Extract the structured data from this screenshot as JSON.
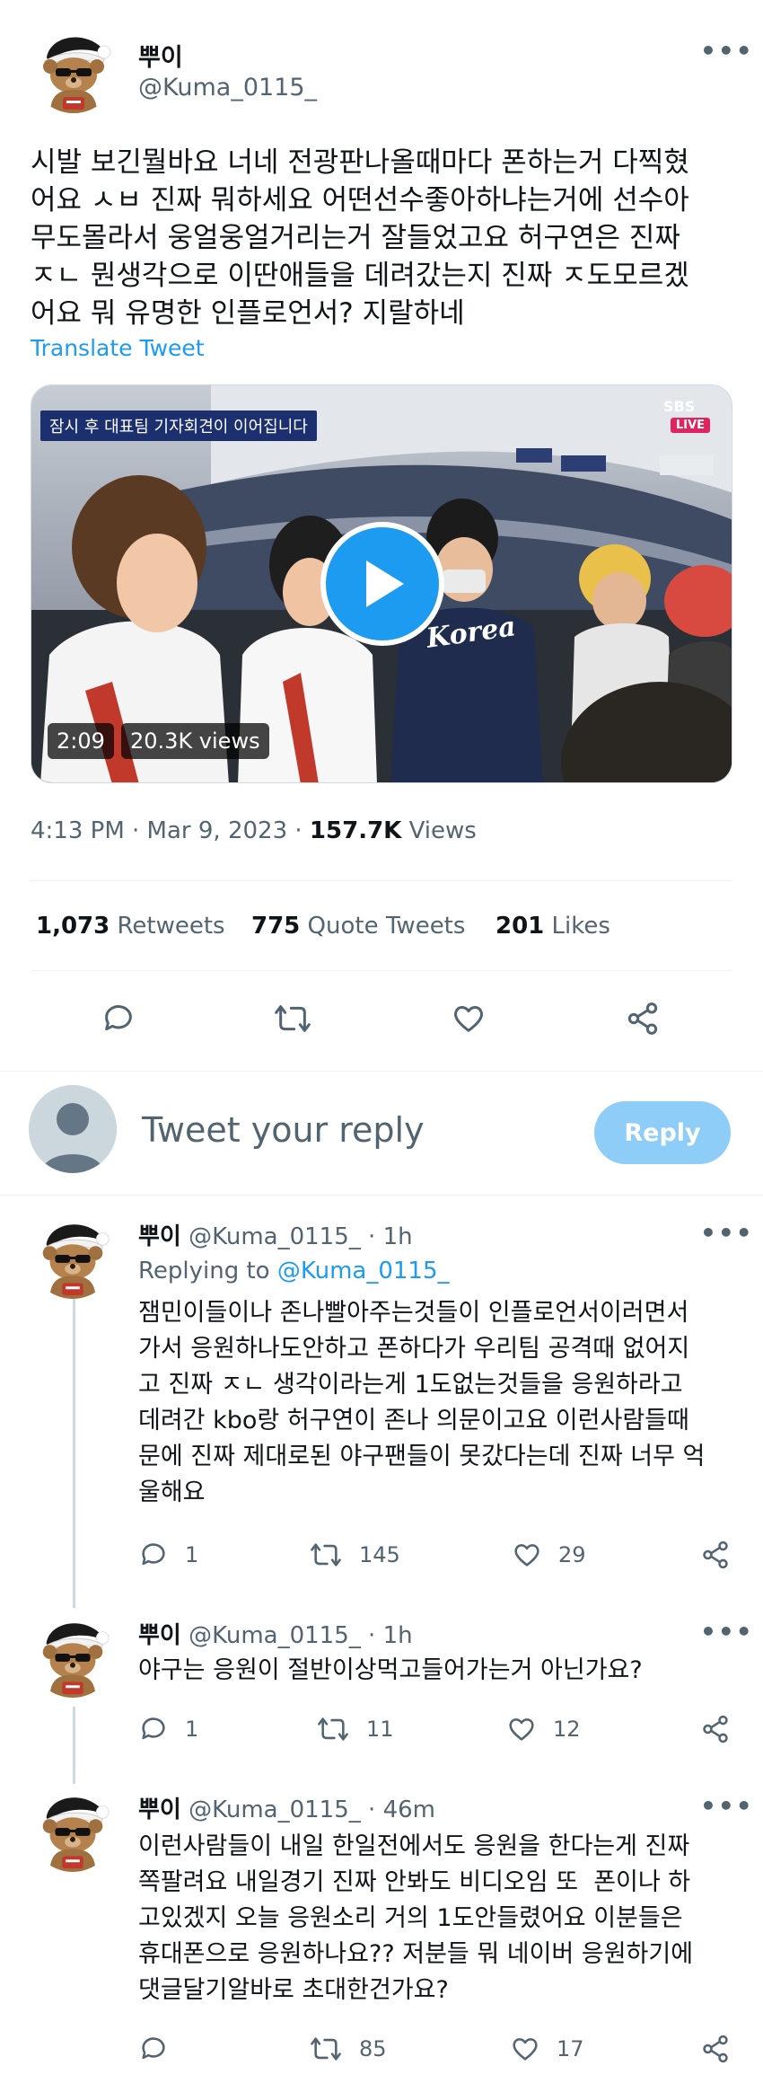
{
  "tweet": {
    "author_name": "뿌이",
    "author_handle": "@Kuma_0115_",
    "lines": [
      "시발 보긴뭘바요 너네 전광판나올때마다 폰하는거 다찍혔",
      "어요 ㅅㅂ 진짜 뭐하세요 어떤선수좋아하냐는거에 선수아",
      "무도몰라서 웅얼웅얼거리는거 잘들었고요 허구연은 진짜",
      "ㅈㄴ 뭔생각으로 이딴애들을 데려갔는지 진짜 ㅈ도모르겠",
      "어요 뭐 유명한 인플로언서? 지랄하네"
    ],
    "translate_label": "Translate Tweet",
    "video": {
      "overlay_caption": "잠시 후 대표팀 기자회견이 이어집니다",
      "broadcaster": "SBS",
      "live_label": "LIVE",
      "jersey_text": "Korea",
      "duration": "2:09",
      "views": "20.3K views"
    },
    "timestamp": "4:13 PM · Mar 9, 2023 · ",
    "view_count": "157.7K",
    "view_label": " Views",
    "stats": {
      "retweets_count": "1,073",
      "retweets_label": " Retweets",
      "quotes_count": "775",
      "quotes_label": " Quote Tweets",
      "likes_count": "201",
      "likes_label": " Likes"
    }
  },
  "composer": {
    "placeholder": "Tweet your reply",
    "reply_button": "Reply"
  },
  "replies": [
    {
      "name": "뿌이",
      "handle_time": "@Kuma_0115_ · 1h",
      "replying_prefix": "Replying to ",
      "replying_to": "@Kuma_0115_",
      "lines": [
        "잼민이들이나 존나빨아주는것들이 인플로언서이러면서",
        "가서 응원하나도안하고 폰하다가 우리팀 공격때 없어지",
        "고 진짜 ㅈㄴ 생각이라는게 1도없는것들을 응원하라고",
        "데려간 kbo랑 허구연이 존나 의문이고요 이런사람들때",
        "문에 진짜 제대로된 야구팬들이 못갔다는데 진짜 너무 억",
        "울해요"
      ],
      "replies_count": "1",
      "retweets_count": "145",
      "likes_count": "29"
    },
    {
      "name": "뿌이",
      "handle_time": "@Kuma_0115_ · 1h",
      "lines": [
        "야구는 응원이 절반이상먹고들어가는거 아닌가요?"
      ],
      "replies_count": "1",
      "retweets_count": "11",
      "likes_count": "12"
    },
    {
      "name": "뿌이",
      "handle_time": "@Kuma_0115_ · 46m",
      "lines": [
        "이런사람들이 내일 한일전에서도 응원을 한다는게 진짜",
        "쪽팔려요 내일경기 진짜 안봐도 비디오임 또  폰이나 하",
        "고있겠지 오늘 응원소리 거의 1도안들렸어요 이분들은",
        "휴대폰으로 응원하나요?? 저분들 뭐 네이버 응원하기에",
        "댓글달기알바로 초대한건가요?"
      ],
      "replies_count": "",
      "retweets_count": "85",
      "likes_count": "17"
    }
  ],
  "colors": {
    "accent": "#1d9bf0",
    "reply_button_bg": "#8ecdf8",
    "text_secondary": "#536471"
  }
}
